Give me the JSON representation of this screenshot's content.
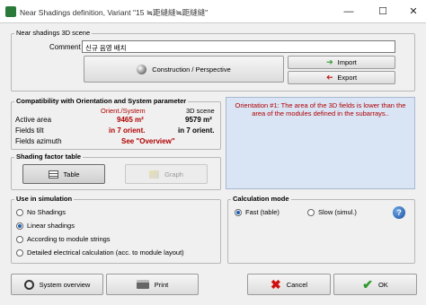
{
  "window": {
    "title": "Near Shadings definition, Variant \"15 ≒距縫縫≒距縫縫\"",
    "minimize": "—",
    "maximize": "☐",
    "close": "✕"
  },
  "scene": {
    "group_label": "Near shadings 3D scene",
    "comment_label": "Comment",
    "comment_value": "신규 음영 배치",
    "construction_button": "Construction / Perspective",
    "import_button": "Import",
    "export_button": "Export"
  },
  "compat": {
    "group_label": "Compatibility with Orientation and System parameter",
    "col1": "Orient./System",
    "col2": "3D scene",
    "rows": [
      {
        "label": "Active area",
        "v1": "9465 m²",
        "v2": "9579 m²"
      },
      {
        "label": "Fields tilt",
        "v1": "in 7 orient.",
        "v2": "in 7 orient."
      },
      {
        "label": "Fields azimuth",
        "v1": "See \"Overview\"",
        "v2": ""
      }
    ],
    "message": "Orientation #1:  The area of the 3D fields is lower than the area of the modules defined in the subarrays.."
  },
  "table": {
    "group_label": "Shading factor table",
    "table_button": "Table",
    "graph_button": "Graph"
  },
  "use": {
    "group_label": "Use in simulation",
    "options": [
      {
        "label": "No Shadings",
        "selected": false
      },
      {
        "label": "Linear shadings",
        "selected": true
      },
      {
        "label": "According to module strings",
        "selected": false
      },
      {
        "label": "Detailed electrical calculation (acc. to module layout)",
        "selected": false
      }
    ]
  },
  "calc": {
    "group_label": "Calculation mode",
    "options": [
      {
        "label": "Fast (table)",
        "selected": true
      },
      {
        "label": "Slow (simul.)",
        "selected": false
      }
    ],
    "help": "?"
  },
  "footer": {
    "overview_button": "System overview",
    "print_button": "Print",
    "cancel_button": "Cancel",
    "ok_button": "OK"
  }
}
